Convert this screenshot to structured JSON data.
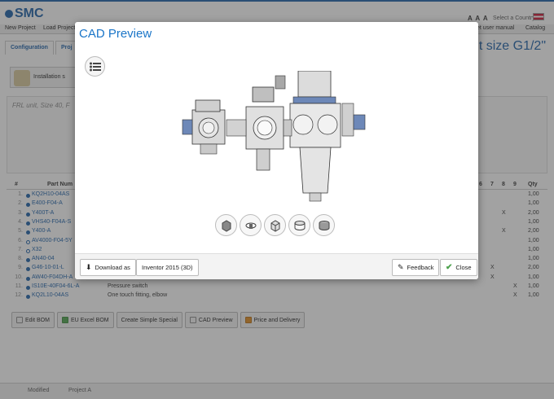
{
  "brand": {
    "logo": "SMC"
  },
  "header": {
    "font_size_control": "A A A",
    "country_label": "Select a Country"
  },
  "menu": {
    "items": [
      "New Project",
      "Load Project",
      "et user manual",
      "Catalog"
    ]
  },
  "tabs": [
    {
      "label": "Configuration"
    },
    {
      "label": "Proj"
    }
  ],
  "page_title": "t size G1/2\"",
  "install": {
    "label": "Installation s"
  },
  "panel": {
    "summary": "FRL unit, Size 40, F"
  },
  "bom": {
    "headers": {
      "num": "#",
      "part": "Part Num",
      "c6": "6",
      "c7": "7",
      "c8": "8",
      "c9": "9",
      "qty": "Qty"
    },
    "rows": [
      {
        "num": "1.",
        "part": "KQ2H10-04AS",
        "desc": "",
        "qty": "1,00",
        "hollow": false
      },
      {
        "num": "2.",
        "part": "E400-F04-A",
        "desc": "",
        "qty": "1,00",
        "hollow": false
      },
      {
        "num": "3.",
        "part": "Y400T-A",
        "desc": "",
        "qty": "2,00",
        "hollow": false,
        "x": "X"
      },
      {
        "num": "4.",
        "part": "VHS40-F04A-S",
        "desc": "",
        "qty": "1,00",
        "hollow": false
      },
      {
        "num": "5.",
        "part": "Y400-A",
        "desc": "",
        "qty": "2,00",
        "hollow": false,
        "x": "X"
      },
      {
        "num": "6.",
        "part": "AV4000-F04-5Y",
        "desc": "",
        "qty": "1,00",
        "hollow": true
      },
      {
        "num": "7.",
        "part": "X32",
        "desc": "",
        "qty": "1,00",
        "hollow": true
      },
      {
        "num": "8.",
        "part": "AN40-04",
        "desc": "",
        "qty": "1,00",
        "hollow": false
      },
      {
        "num": "9.",
        "part": "G46-10-01-L",
        "desc": "",
        "qty": "2,00",
        "hollow": false,
        "x": "X"
      },
      {
        "num": "10.",
        "part": "AW40-F04DH-A",
        "desc": "",
        "qty": "1,00",
        "hollow": false,
        "x": "X"
      },
      {
        "num": "11.",
        "part": "IS10E-40F04-6L-A",
        "desc": "Pressure switch",
        "qty": "1,00",
        "hollow": false,
        "x": "X"
      },
      {
        "num": "12.",
        "part": "KQ2L10-04AS",
        "desc": "One touch fitting, elbow",
        "qty": "1,00",
        "hollow": false,
        "x": "X"
      }
    ]
  },
  "actions": [
    {
      "label": "Edit BOM",
      "icon": "edit-icon"
    },
    {
      "label": "EU Excel BOM",
      "icon": "excel-icon"
    },
    {
      "label": "Create Simple Special",
      "icon": ""
    },
    {
      "label": "CAD Preview",
      "icon": "cube-icon"
    },
    {
      "label": "Price and Delivery",
      "icon": "cart-icon"
    }
  ],
  "footer": {
    "status": "Modified",
    "project": "Project A"
  },
  "modal": {
    "title": "CAD Preview",
    "download_label": "Download as",
    "format_label": "Inventor 2015 (3D)",
    "feedback_label": "Feedback",
    "close_label": "Close"
  },
  "colors": {
    "accent": "#1a75c8",
    "brand": "#1a5fa8",
    "overlay": "#3c3c3c"
  }
}
